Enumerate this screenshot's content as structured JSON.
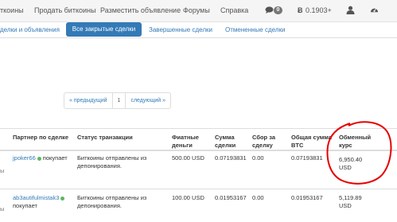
{
  "nav": {
    "item_bitcoins": "ткоины",
    "sell": "Продать биткоины",
    "post_ad": "Разместить объявление",
    "forums": "Форумы",
    "help": "Справка",
    "messages_count": "0",
    "balance": "0.1903+"
  },
  "tabs": {
    "deals_and_ads": "делки и объявления",
    "closed": "Все закрытые сделки",
    "completed": "Завершенные сделки",
    "cancelled": "Отмененные сделки"
  },
  "pager": {
    "prev": "« предыдущий",
    "page": "1",
    "next": "следующий »"
  },
  "table": {
    "headers": {
      "partner": "Партнер по сделке",
      "status": "Статус транзакции",
      "fiat_line1": "Фиатные",
      "fiat_line2": "деньги",
      "sum_line1": "Сумма",
      "sum_line2": "сделки",
      "fee_line1": "Сбор за",
      "fee_line2": "сделку",
      "total_line1": "Общая сумма",
      "total_line2": "BTC",
      "rate_line1": "Обменный",
      "rate_line2": "курс"
    },
    "rows": [
      {
        "left_edge": "ы",
        "partner": "jpoker66",
        "action": "покупает",
        "status_line1": "Биткоины отправлены из",
        "status_line2": "депонирования.",
        "fiat": "500.00 USD",
        "amount": "0.07193831",
        "fee": "0.00",
        "total": "0.07193831",
        "rate_line1": "6,950.40",
        "rate_line2": "USD"
      },
      {
        "left_edge": "ы",
        "partner": "ab3autifulmistak3",
        "action": "покупает",
        "status_line1": "Биткоины отправлены из",
        "status_line2": "депонирования.",
        "fiat": "100.00 USD",
        "amount": "0.01953167",
        "fee": "0.00",
        "total": "0.01953167",
        "rate_line1": "5,119.89",
        "rate_line2": "USD"
      }
    ]
  },
  "colors": {
    "link": "#337ab7",
    "online": "#5cb85c",
    "annotation": "#e60000"
  }
}
